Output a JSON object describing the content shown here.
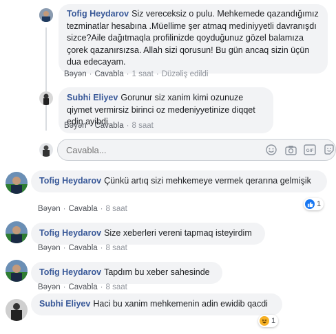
{
  "comments": [
    {
      "author": "Tofig Heydarov",
      "text": "Siz vereceksiz o pulu. Mehkemede qazandığımız tezminatlar hesabına .Müellime şer atmaq mediniyyetli davranışdı sizce?Aile dağıtmaqla profilinizde qoyduğunuz gözel balamıza çorek qazanırsızsa. Allah sizi qorusun! Bu gün ancaq sizin üçün dua edecayam.",
      "like": "Bəyən",
      "reply": "Cavabla",
      "time": "1 saat",
      "edited": "Düzəliş edildi"
    },
    {
      "author": "Subhi Eliyev",
      "text": "Gorunur siz xanim kimi ozunuze qiymet vermirsiz birinci oz medeniyyetinize diqqet edin ayibdi",
      "like": "Bəyən",
      "reply": "Cavabla",
      "time": "8 saat"
    },
    {
      "author": "Tofig Heydarov",
      "text": "Çünkü artıq sizi mehkemeye vermek qerarına gelmişik",
      "like": "Bəyən",
      "reply": "Cavabla",
      "time": "8 saat",
      "reaction_count": "1"
    },
    {
      "author": "Tofig Heydarov",
      "text": "Size xeberleri vereni tapmaq isteyirdim",
      "like": "Bəyən",
      "reply": "Cavabla",
      "time": "8 saat"
    },
    {
      "author": "Tofig Heydarov",
      "text": "Tapdım bu xeber sahesinde",
      "like": "Bəyən",
      "reply": "Cavabla",
      "time": "8 saat"
    },
    {
      "author": "Subhi Eliyev",
      "text": "Haci bu xanim mehkemenin adin ewidib qacdi",
      "reaction_count": "1"
    }
  ],
  "reply_input": {
    "placeholder": "Cavabla..."
  },
  "icons": {
    "emoji": "emoji-icon",
    "camera": "camera-icon",
    "gif": "gif-icon",
    "sticker": "sticker-icon",
    "like_reaction": "like-reaction-icon",
    "haha_reaction": "haha-reaction-icon"
  },
  "colors": {
    "author": "#385898",
    "bubble": "#f2f3f5",
    "meta": "#90949c",
    "like_blue": "#1877f2",
    "haha_yellow": "#f7b125"
  }
}
